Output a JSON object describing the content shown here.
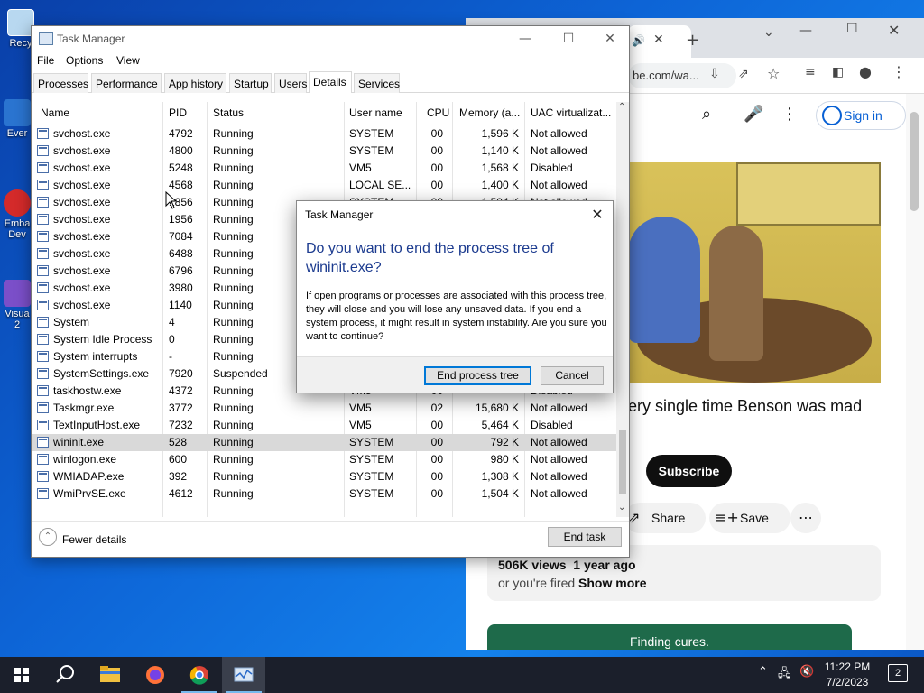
{
  "desktop": {
    "icons": [
      {
        "label": "Recy",
        "icon": "recycle-bin-icon",
        "color": "#b8d8f0"
      },
      {
        "label": "Ever",
        "icon": "app-icon",
        "color": "#2a74d0"
      },
      {
        "label": "Emba",
        "label2": "Dev",
        "icon": "app-icon",
        "color": "#d42a2a"
      },
      {
        "label": "Visua",
        "label2": "2",
        "icon": "visual-studio-icon",
        "color": "#7b4fc9"
      }
    ]
  },
  "browser": {
    "address": "be.com/wa...",
    "sign_in": "Sign in",
    "video_title": "ery single time Benson was mad",
    "subscribe": "Subscribe",
    "share": "Share",
    "save": "Save",
    "views": "506K views",
    "age": "1 year ago",
    "desc_text": "or you're fired",
    "show_more": "Show more",
    "ad_text": "Finding cures."
  },
  "task_manager": {
    "title": "Task Manager",
    "menu": [
      "File",
      "Options",
      "View"
    ],
    "tabs": [
      "Processes",
      "Performance",
      "App history",
      "Startup",
      "Users",
      "Details",
      "Services"
    ],
    "active_tab": "Details",
    "columns": [
      "Name",
      "PID",
      "Status",
      "User name",
      "CPU",
      "Memory (a...",
      "UAC virtualizat..."
    ],
    "rows": [
      [
        "svchost.exe",
        "4792",
        "Running",
        "SYSTEM",
        "00",
        "1,596 K",
        "Not allowed"
      ],
      [
        "svchost.exe",
        "4800",
        "Running",
        "SYSTEM",
        "00",
        "1,140 K",
        "Not allowed"
      ],
      [
        "svchost.exe",
        "5248",
        "Running",
        "VM5",
        "00",
        "1,568 K",
        "Disabled"
      ],
      [
        "svchost.exe",
        "4568",
        "Running",
        "LOCAL SE...",
        "00",
        "1,400 K",
        "Not allowed"
      ],
      [
        "svchost.exe",
        "1856",
        "Running",
        "SYSTEM",
        "00",
        "1,504 K",
        "Not allowed"
      ],
      [
        "svchost.exe",
        "1956",
        "Running",
        "",
        "",
        "",
        ""
      ],
      [
        "svchost.exe",
        "7084",
        "Running",
        "",
        "",
        "",
        ""
      ],
      [
        "svchost.exe",
        "6488",
        "Running",
        "",
        "",
        "",
        ""
      ],
      [
        "svchost.exe",
        "6796",
        "Running",
        "",
        "",
        "",
        ""
      ],
      [
        "svchost.exe",
        "3980",
        "Running",
        "",
        "",
        "",
        ""
      ],
      [
        "svchost.exe",
        "1140",
        "Running",
        "",
        "",
        "",
        ""
      ],
      [
        "System",
        "4",
        "Running",
        "",
        "",
        "",
        ""
      ],
      [
        "System Idle Process",
        "0",
        "Running",
        "",
        "",
        "",
        ""
      ],
      [
        "System interrupts",
        "-",
        "Running",
        "",
        "",
        "",
        ""
      ],
      [
        "SystemSettings.exe",
        "7920",
        "Suspended",
        "",
        "",
        "",
        ""
      ],
      [
        "taskhostw.exe",
        "4372",
        "Running",
        "VM5",
        "00",
        "",
        "Disabled"
      ],
      [
        "Taskmgr.exe",
        "3772",
        "Running",
        "VM5",
        "02",
        "15,680 K",
        "Not allowed"
      ],
      [
        "TextInputHost.exe",
        "7232",
        "Running",
        "VM5",
        "00",
        "5,464 K",
        "Disabled"
      ],
      [
        "wininit.exe",
        "528",
        "Running",
        "SYSTEM",
        "00",
        "792 K",
        "Not allowed"
      ],
      [
        "winlogon.exe",
        "600",
        "Running",
        "SYSTEM",
        "00",
        "980 K",
        "Not allowed"
      ],
      [
        "WMIADAP.exe",
        "392",
        "Running",
        "SYSTEM",
        "00",
        "1,308 K",
        "Not allowed"
      ],
      [
        "WmiPrvSE.exe",
        "4612",
        "Running",
        "SYSTEM",
        "00",
        "1,504 K",
        "Not allowed"
      ]
    ],
    "selected_row": 18,
    "fewer_details": "Fewer details",
    "end_task": "End task"
  },
  "dialog": {
    "title": "Task Manager",
    "heading": "Do you want to end the process tree of wininit.exe?",
    "body": "If open programs or processes are associated with this process tree, they will close and you will lose any unsaved data. If you end a system process, it might result in system instability. Are you sure you want to continue?",
    "confirm": "End process tree",
    "cancel": "Cancel"
  },
  "taskbar": {
    "time": "11:22 PM",
    "date": "7/2/2023",
    "notification_count": "2",
    "apps": [
      "start-icon",
      "search-icon",
      "file-explorer-icon",
      "firefox-icon",
      "chrome-icon",
      "task-manager-icon"
    ]
  },
  "colors": {
    "accent": "#0078d7",
    "dialog_heading": "#1c3b8f",
    "selected_row": "#d9d9d9",
    "youtube_link": "#065fd4"
  }
}
